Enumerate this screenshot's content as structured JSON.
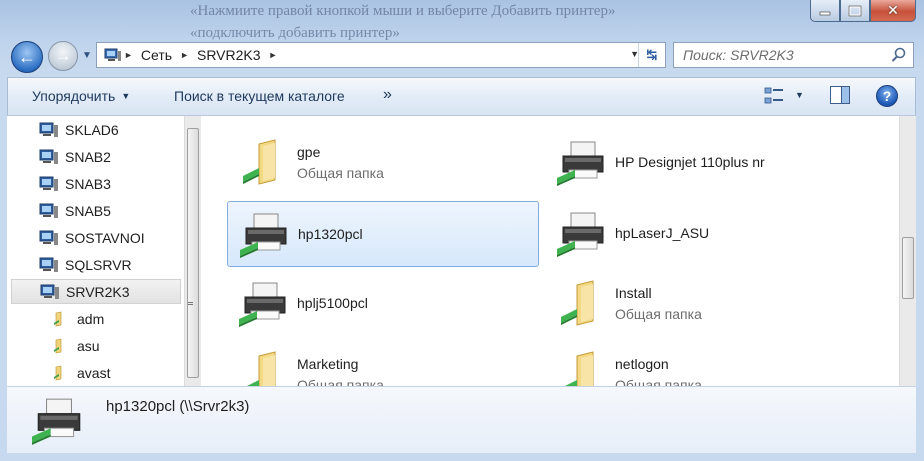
{
  "background_text": {
    "line1": "«Нажмиите правой кнопкой мыши и выберите Добавить принтер»",
    "line2": "«подключить добавить принтер»"
  },
  "address_bar": {
    "segments": [
      "Сеть",
      "SRVR2K3"
    ]
  },
  "search": {
    "placeholder": "Поиск: SRVR2K3"
  },
  "toolbar": {
    "organize_label": "Упорядочить",
    "search_catalog_label": "Поиск в текущем каталоге",
    "more_label": "»"
  },
  "nav_pane": {
    "items": [
      {
        "label": "SKLAD6",
        "kind": "computer"
      },
      {
        "label": "SNAB2",
        "kind": "computer"
      },
      {
        "label": "SNAB3",
        "kind": "computer"
      },
      {
        "label": "SNAB5",
        "kind": "computer"
      },
      {
        "label": "SOSTAVNOI",
        "kind": "computer"
      },
      {
        "label": "SQLSRVR",
        "kind": "computer"
      },
      {
        "label": "SRVR2K3",
        "kind": "computer",
        "selected": true
      },
      {
        "label": "adm",
        "kind": "share"
      },
      {
        "label": "asu",
        "kind": "share"
      },
      {
        "label": "avast",
        "kind": "share"
      }
    ]
  },
  "content": {
    "tiles": [
      {
        "name": "gpe",
        "sub": "Общая папка",
        "kind": "folder"
      },
      {
        "name": "HP Designjet 110plus nr",
        "sub": "",
        "kind": "printer"
      },
      {
        "name": "hp1320pcl",
        "sub": "",
        "kind": "printer",
        "selected": true
      },
      {
        "name": "hpLaserJ_ASU",
        "sub": "",
        "kind": "printer"
      },
      {
        "name": "hplj5100pcl",
        "sub": "",
        "kind": "printer"
      },
      {
        "name": "Install",
        "sub": "Общая папка",
        "kind": "folder"
      },
      {
        "name": "Marketing",
        "sub": "Общая папка",
        "kind": "folder"
      },
      {
        "name": "netlogon",
        "sub": "Общая папка",
        "kind": "folder"
      }
    ]
  },
  "details": {
    "name": "hp1320pcl (\\\\Srvr2k3)"
  },
  "colors": {
    "accent": "#3a6fb5",
    "selection": "#d6e8fb"
  }
}
